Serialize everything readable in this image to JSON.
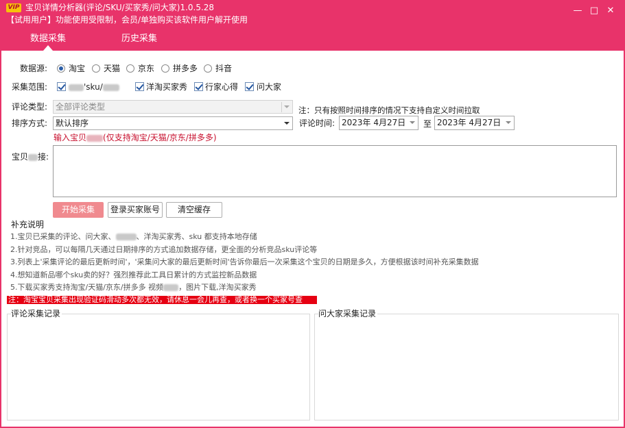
{
  "window": {
    "vip_badge": "VIP",
    "title": "宝贝详情分析器(评论/SKU/买家秀/问大家)1.0.5.28",
    "trial_notice": "【试用用户】功能使用受限制，会员/单独购买该软件用户解开使用",
    "controls": {
      "minimize": "—",
      "maximize": "□",
      "close": "✕"
    }
  },
  "tabs": [
    {
      "label": "数据采集",
      "active": true
    },
    {
      "label": "历史采集",
      "active": false
    }
  ],
  "source": {
    "label": "数据源:",
    "options": [
      "淘宝",
      "天猫",
      "京东",
      "拼多多",
      "抖音"
    ],
    "selected": "淘宝"
  },
  "scope": {
    "label": "采集范围:",
    "items": [
      {
        "label": "'sku/",
        "checked": true
      },
      {
        "label": "洋淘买家秀",
        "checked": true
      },
      {
        "label": "行家心得",
        "checked": true
      },
      {
        "label": "问大家",
        "checked": true
      }
    ]
  },
  "comment_type": {
    "label": "评论类型:",
    "value": "全部评论类型",
    "note": "注：只有按照时间排序的情况下支持自定义时间拉取"
  },
  "sort": {
    "label": "排序方式:",
    "value": "默认排序"
  },
  "comment_time": {
    "label": "评论时间:",
    "from": "2023年 4月27日",
    "to_label": "至",
    "to": "2023年 4月27日"
  },
  "input_hint": {
    "prefix": "输入宝贝",
    "suffix": "(仅支持淘宝/天猫/京东/拼多多)"
  },
  "product_field": {
    "label_prefix": "宝贝",
    "label_suffix": "接:",
    "value": ""
  },
  "buttons": {
    "start": "开始采集",
    "login": "登录买家账号",
    "clear": "清空缓存"
  },
  "notes": {
    "title": "补充说明",
    "lines": [
      {
        "a": "1.宝贝已采集的评论、问大家、",
        "b": "、洋淘买家秀、sku 都支持本地存储"
      },
      {
        "a": "2.针对竞品，可以每隔几天通过日期排序的方式追加数据存储，更全面的分析竞品sku评论等",
        "b": ""
      },
      {
        "a": "3.列表上'采集评论的最后更新时间'，'采集问大家的最后更新时间'告诉你最后一次采集这个宝贝的日期是多久，方便根据该时间补充采集数据",
        "b": ""
      },
      {
        "a": "4.想知道新品哪个sku卖的好？强烈推荐此工具日累计的方式监控新品数据",
        "b": ""
      },
      {
        "a": "5.下载买家秀支持淘宝/天猫/京东/拼多多 视频",
        "b": "，图片下载,洋淘买家秀"
      }
    ],
    "warning": "注：淘宝宝贝采集出现验证码滑动多次都无效，请休息一会儿再查，或者换一个买家号查"
  },
  "panels": {
    "comments": "评论采集记录",
    "questions": "问大家采集记录"
  },
  "colors": {
    "brand": "#e8336a",
    "primary_button": "#f08a8f",
    "warning": "#e60012",
    "hint_red": "#c8102e"
  }
}
